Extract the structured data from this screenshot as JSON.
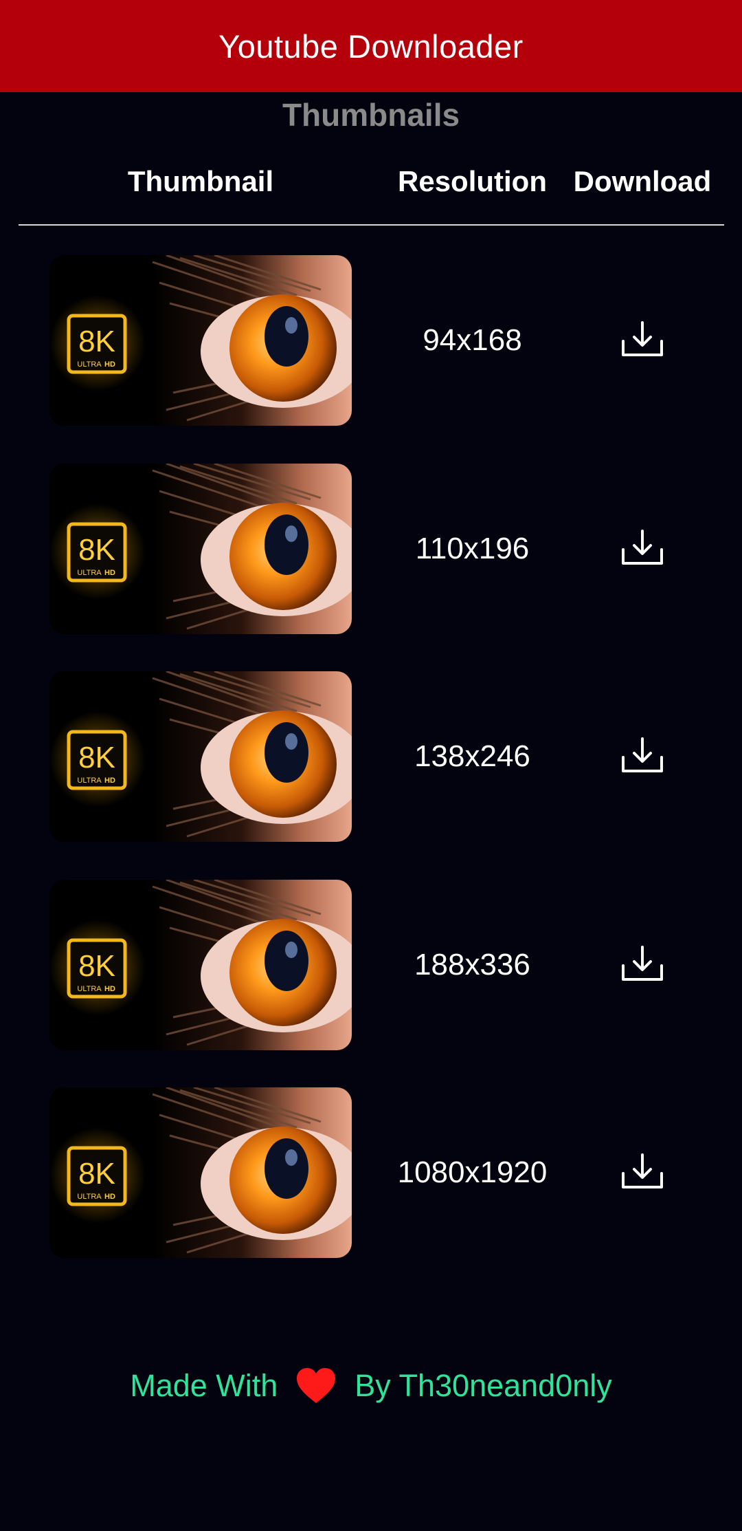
{
  "header": {
    "title": "Youtube Downloader"
  },
  "section": {
    "title": "Thumbnails"
  },
  "table": {
    "columns": {
      "thumbnail": "Thumbnail",
      "resolution": "Resolution",
      "download": "Download"
    },
    "rows": [
      {
        "resolution": "94x168"
      },
      {
        "resolution": "110x196"
      },
      {
        "resolution": "138x246"
      },
      {
        "resolution": "188x336"
      },
      {
        "resolution": "1080x1920"
      }
    ],
    "badge": {
      "big": "8K",
      "small_left": "ULTRA",
      "small_right": "HD"
    }
  },
  "footer": {
    "made_with": "Made With",
    "by": "By Th30neand0nly"
  },
  "colors": {
    "header_bg": "#b3000a",
    "background": "#03020f",
    "footer_text": "#2fe39a",
    "heart": "#ff1a1a",
    "badge_gold": "#f2b81c"
  },
  "icons": {
    "download": "download-icon",
    "heart": "heart-icon"
  }
}
